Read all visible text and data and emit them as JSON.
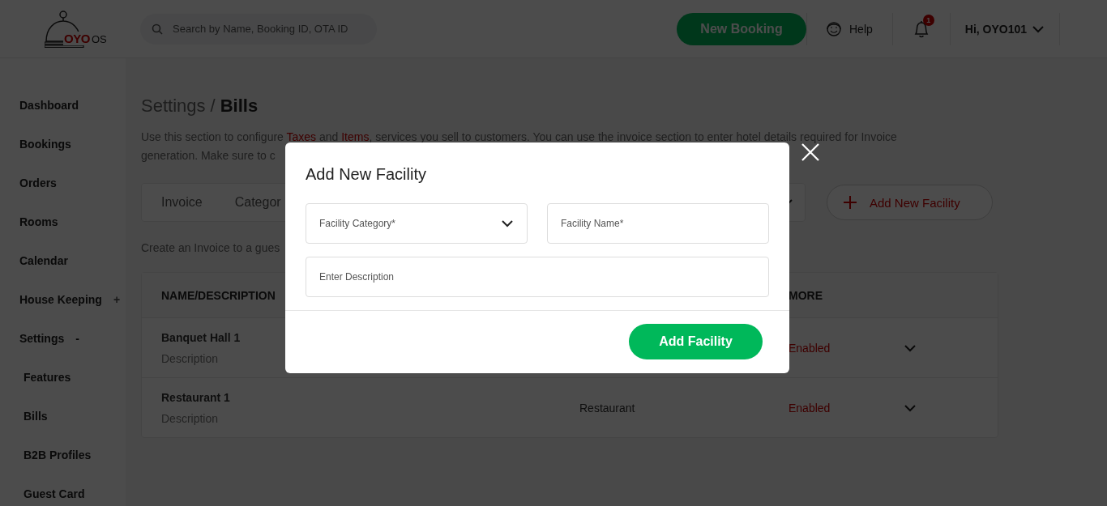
{
  "header": {
    "logo": {
      "brand": "OYO",
      "suffix": "OS"
    },
    "search": {
      "placeholder": "Search by Name, Booking ID, OTA ID"
    },
    "new_booking": "New Booking",
    "help": "Help",
    "notifications": {
      "count": "1"
    },
    "user": "Hi, OYO101"
  },
  "sidebar": {
    "items": [
      {
        "label": "Dashboard"
      },
      {
        "label": "Bookings"
      },
      {
        "label": "Orders"
      },
      {
        "label": "Rooms"
      },
      {
        "label": "Calendar"
      },
      {
        "label": "House Keeping",
        "toggle": "+",
        "expanded": false
      },
      {
        "label": "Settings",
        "toggle": "-",
        "expanded": true,
        "children": [
          {
            "label": "Features"
          },
          {
            "label": "Bills"
          },
          {
            "label": "B2B Profiles"
          },
          {
            "label": "Guest Card"
          }
        ]
      }
    ]
  },
  "page": {
    "breadcrumb": {
      "parent": "Settings /",
      "current": "Bills"
    },
    "intro": [
      {
        "kind": "text",
        "text": "Use this section to configure "
      },
      {
        "kind": "link",
        "text": "Taxes"
      },
      {
        "kind": "text",
        "text": " and "
      },
      {
        "kind": "link",
        "text": "Items"
      },
      {
        "kind": "text",
        "text": ", services you sell to customers. You can use the invoice section to enter hotel details required for Invoice generation. Make sure to c"
      }
    ],
    "tabs": [
      {
        "label": "Invoice"
      },
      {
        "label": "Categor"
      }
    ],
    "add_button": "Add New Facility",
    "note": "Create an Invoice to a gues",
    "table": {
      "columns": [
        "NAME/DESCRIPTION",
        "MORE"
      ],
      "rows": [
        {
          "name": "Banquet Hall 1",
          "description": "Description",
          "status": "Enabled"
        },
        {
          "name": "Restaurant 1",
          "description": "Description",
          "category": "Restaurant",
          "status": "Enabled"
        }
      ]
    }
  },
  "modal": {
    "title": "Add New Facility",
    "fields": [
      {
        "kind": "select",
        "placeholder": "Facility Category*"
      },
      {
        "kind": "text",
        "placeholder": "Facility Name*"
      },
      {
        "kind": "textarea",
        "placeholder": "Enter Description"
      }
    ],
    "submit": "Add Facility"
  }
}
